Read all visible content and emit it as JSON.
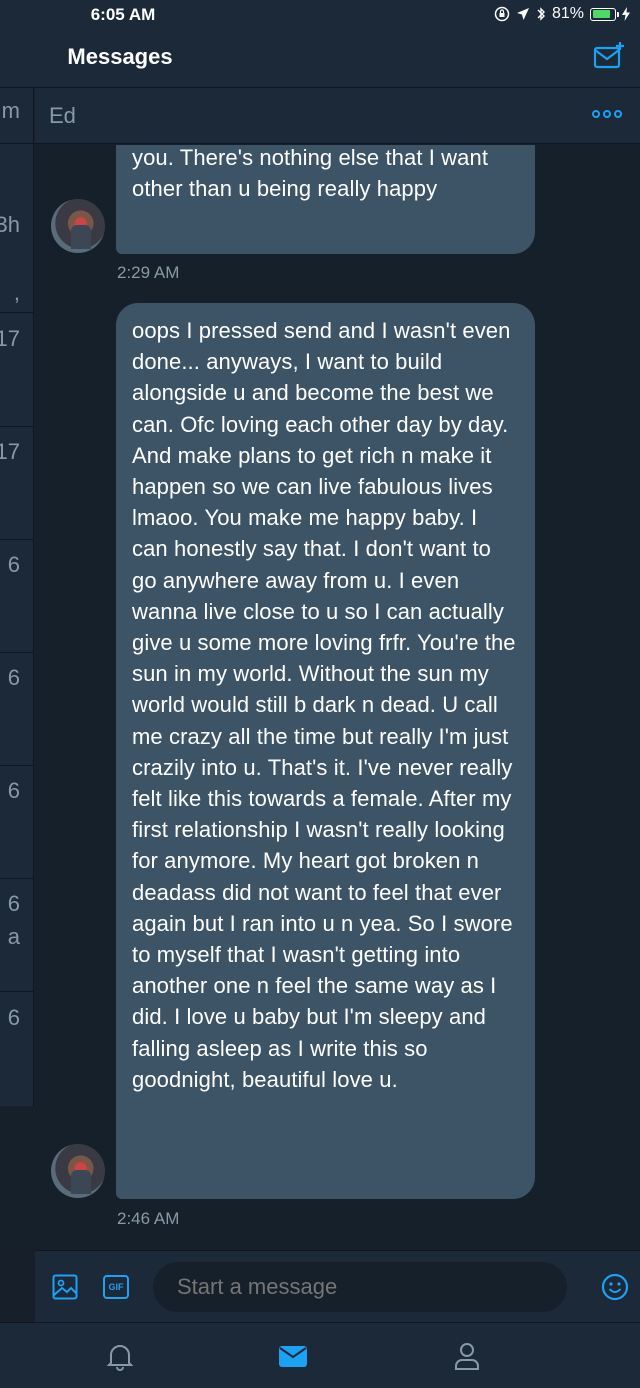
{
  "status_bar": {
    "time": "6:05 AM",
    "battery": "81%",
    "battery_level": 0.81
  },
  "header": {
    "title": "Messages"
  },
  "sidebar": {
    "peeks": [
      "m",
      "3h",
      ",",
      "17",
      "17",
      "6",
      "6",
      "6",
      "6",
      "a",
      "6"
    ]
  },
  "conversation": {
    "name": "Ed",
    "messages": [
      {
        "text": "you. There's nothing else that I want other than u being really happy",
        "time": "2:29 AM"
      },
      {
        "text": "oops I pressed send and I wasn't even done... anyways, I want to build alongside u and become the best we can. Ofc loving each other day by day. And make plans to get rich n make it happen so we can live fabulous lives lmaoo. You make me happy baby. I can honestly say that. I don't want to go anywhere away from u. I even wanna live close to u so I can actually give u some more loving frfr. You're the sun in my world. Without the sun my world would still b dark n dead. U call me crazy all the time but really I'm just crazily into u. That's it. I've never really felt like this towards a female. After my first relationship I wasn't really looking for anymore. My heart got broken n deadass did not want to feel that ever again but I ran into u n yea. So I swore to myself that I wasn't getting into another one n feel the same way as I did. I love u baby but I'm sleepy and falling asleep as I write this so goodnight, beautiful love u.",
        "time": "2:46 AM"
      }
    ]
  },
  "composer": {
    "placeholder": "Start a message",
    "gif_label": "GIF"
  },
  "colors": {
    "accent": "#1da1f2",
    "bubble": "#3d5466",
    "background": "#15202b",
    "bar": "#1c2938",
    "secondary_text": "#8899a6"
  }
}
